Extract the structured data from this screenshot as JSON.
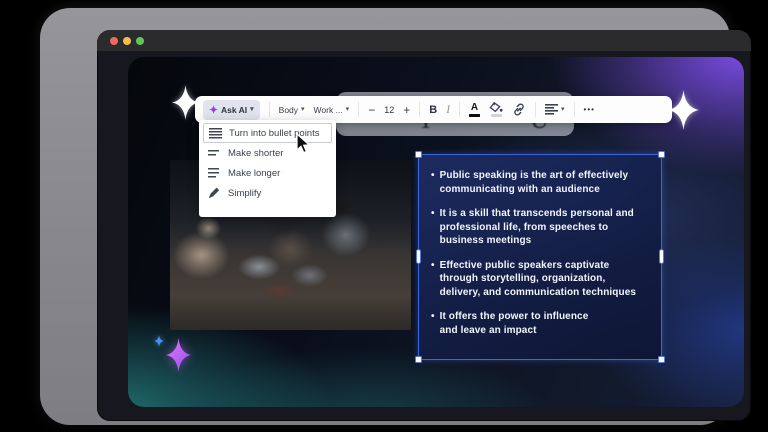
{
  "window": {
    "controls": [
      {
        "name": "close",
        "color": "#ee6a5f"
      },
      {
        "name": "minimize",
        "color": "#f5bd4f"
      },
      {
        "name": "maximize",
        "color": "#61c554"
      }
    ]
  },
  "icons": {
    "caret": "▾",
    "more": "•••"
  },
  "toolbar": {
    "ask_ai_label": "Ask AI",
    "text_style": "Body",
    "font_family": "Work ...",
    "decrease_label": "−",
    "font_size": "12",
    "increase_label": "+",
    "bold_label": "B",
    "italic_label": "I",
    "text_color_label": "A"
  },
  "ai_menu": {
    "items": [
      {
        "label": "Turn into bullet points",
        "icon": "bullet-list-icon",
        "hovered": true
      },
      {
        "label": "Make shorter",
        "icon": "shorten-lines-icon",
        "hovered": false
      },
      {
        "label": "Make longer",
        "icon": "lengthen-lines-icon",
        "hovered": false
      },
      {
        "label": "Simplify",
        "icon": "pen-icon",
        "hovered": false
      }
    ]
  },
  "slide": {
    "bullet_char": "•",
    "bullets": [
      {
        "lines": [
          "Public speaking is the art of effectively",
          "communicating with an audience"
        ]
      },
      {
        "lines": [
          "It is a skill that transcends personal and",
          "professional life, from speeches to",
          "business meetings"
        ]
      },
      {
        "lines": [
          "Effective public speakers captivate",
          "through storytelling, organization,",
          "delivery, and communication techniques"
        ]
      },
      {
        "lines": [
          "It offers the power to influence",
          "and leave an impact"
        ]
      }
    ]
  },
  "ghost": {
    "letters": [
      "T",
      "U"
    ]
  },
  "colors": {
    "selection_blue": "#3a66e0",
    "ai_purple": "#8b4df0",
    "sparkle_magenta": "#c45ef5",
    "sparkle_blue": "#4a90e8",
    "canvas_purple_glow": "#7c4ce6",
    "canvas_teal_glow": "#227476",
    "toolbar_bg": "#fdfdfe"
  }
}
